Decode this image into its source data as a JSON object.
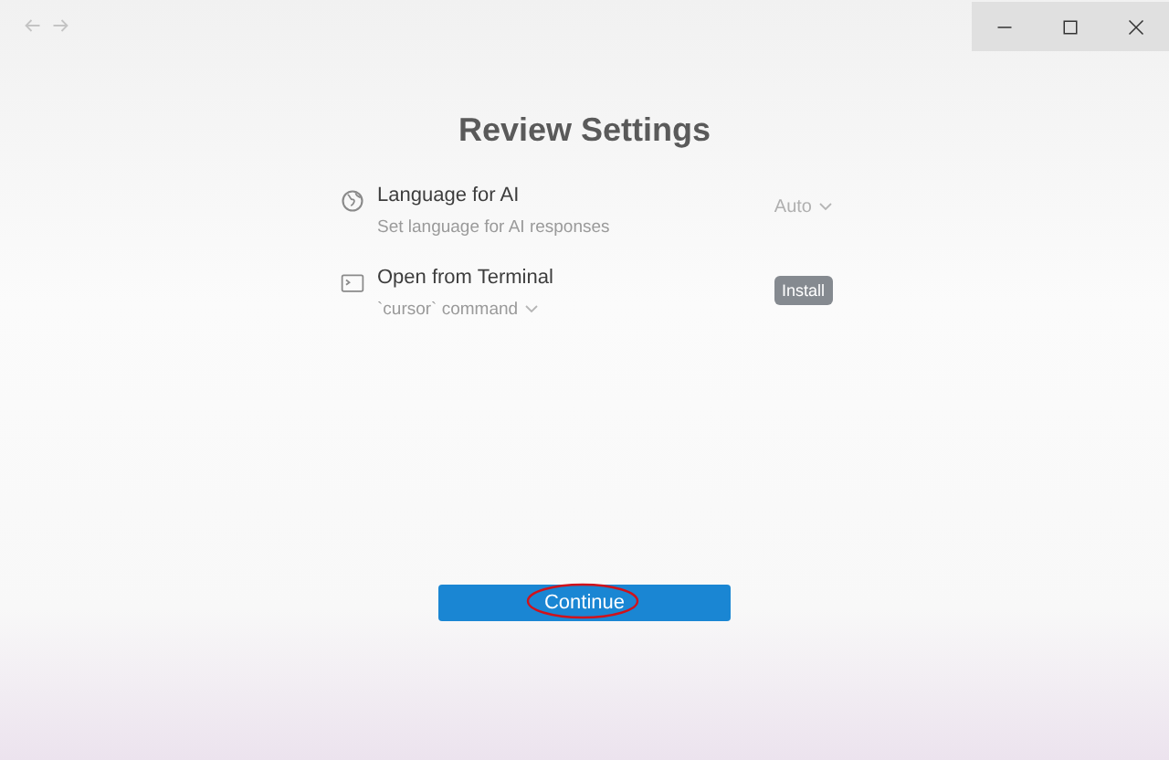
{
  "title_bar": {
    "nav": [
      {
        "kind": "back"
      },
      {
        "kind": "forward"
      }
    ],
    "controls": [
      {
        "kind": "minimize"
      },
      {
        "kind": "maximize"
      },
      {
        "kind": "close"
      }
    ]
  },
  "title": "Review Settings",
  "settings": [
    {
      "kind": "dropdown",
      "label": "Language for AI",
      "description": "Set language for AI responses",
      "value": "Auto"
    },
    {
      "kind": "button",
      "label": "Open from Terminal",
      "description": "`cursor` command",
      "value": "Install"
    }
  ],
  "continue_button": {
    "label": "Continue",
    "annotated": true
  }
}
